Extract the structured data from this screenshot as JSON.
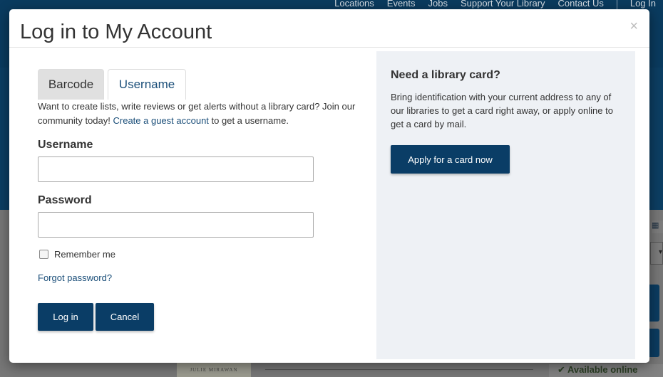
{
  "background": {
    "nav": [
      "Locations",
      "Events",
      "Jobs",
      "Support Your Library",
      "Contact Us",
      "Log In"
    ],
    "book_cover_text": "JULIE MIRAWAN",
    "availability": "Available online"
  },
  "modal": {
    "title": "Log in to My Account",
    "close_label": "×",
    "tabs": [
      {
        "label": "Barcode",
        "active": false
      },
      {
        "label": "Username",
        "active": true
      }
    ],
    "intro": {
      "before": "Want to create lists, write reviews or get alerts without a library card? Join our community today! ",
      "link": "Create a guest account",
      "after": " to get a username."
    },
    "username": {
      "label": "Username",
      "value": "",
      "placeholder": ""
    },
    "password": {
      "label": "Password",
      "value": "",
      "placeholder": ""
    },
    "remember": {
      "label": "Remember me",
      "checked": false
    },
    "forgot_link": "Forgot password?",
    "login_button": "Log in",
    "cancel_button": "Cancel"
  },
  "side_panel": {
    "title": "Need a library card?",
    "text": "Bring identification with your current address to any of our libraries to get a card right away, or apply online to get a card by mail.",
    "apply_button": "Apply for a card now"
  },
  "colors": {
    "brand": "#0a3d66",
    "link": "#1a4e79",
    "panel_bg": "#eef1f5"
  }
}
